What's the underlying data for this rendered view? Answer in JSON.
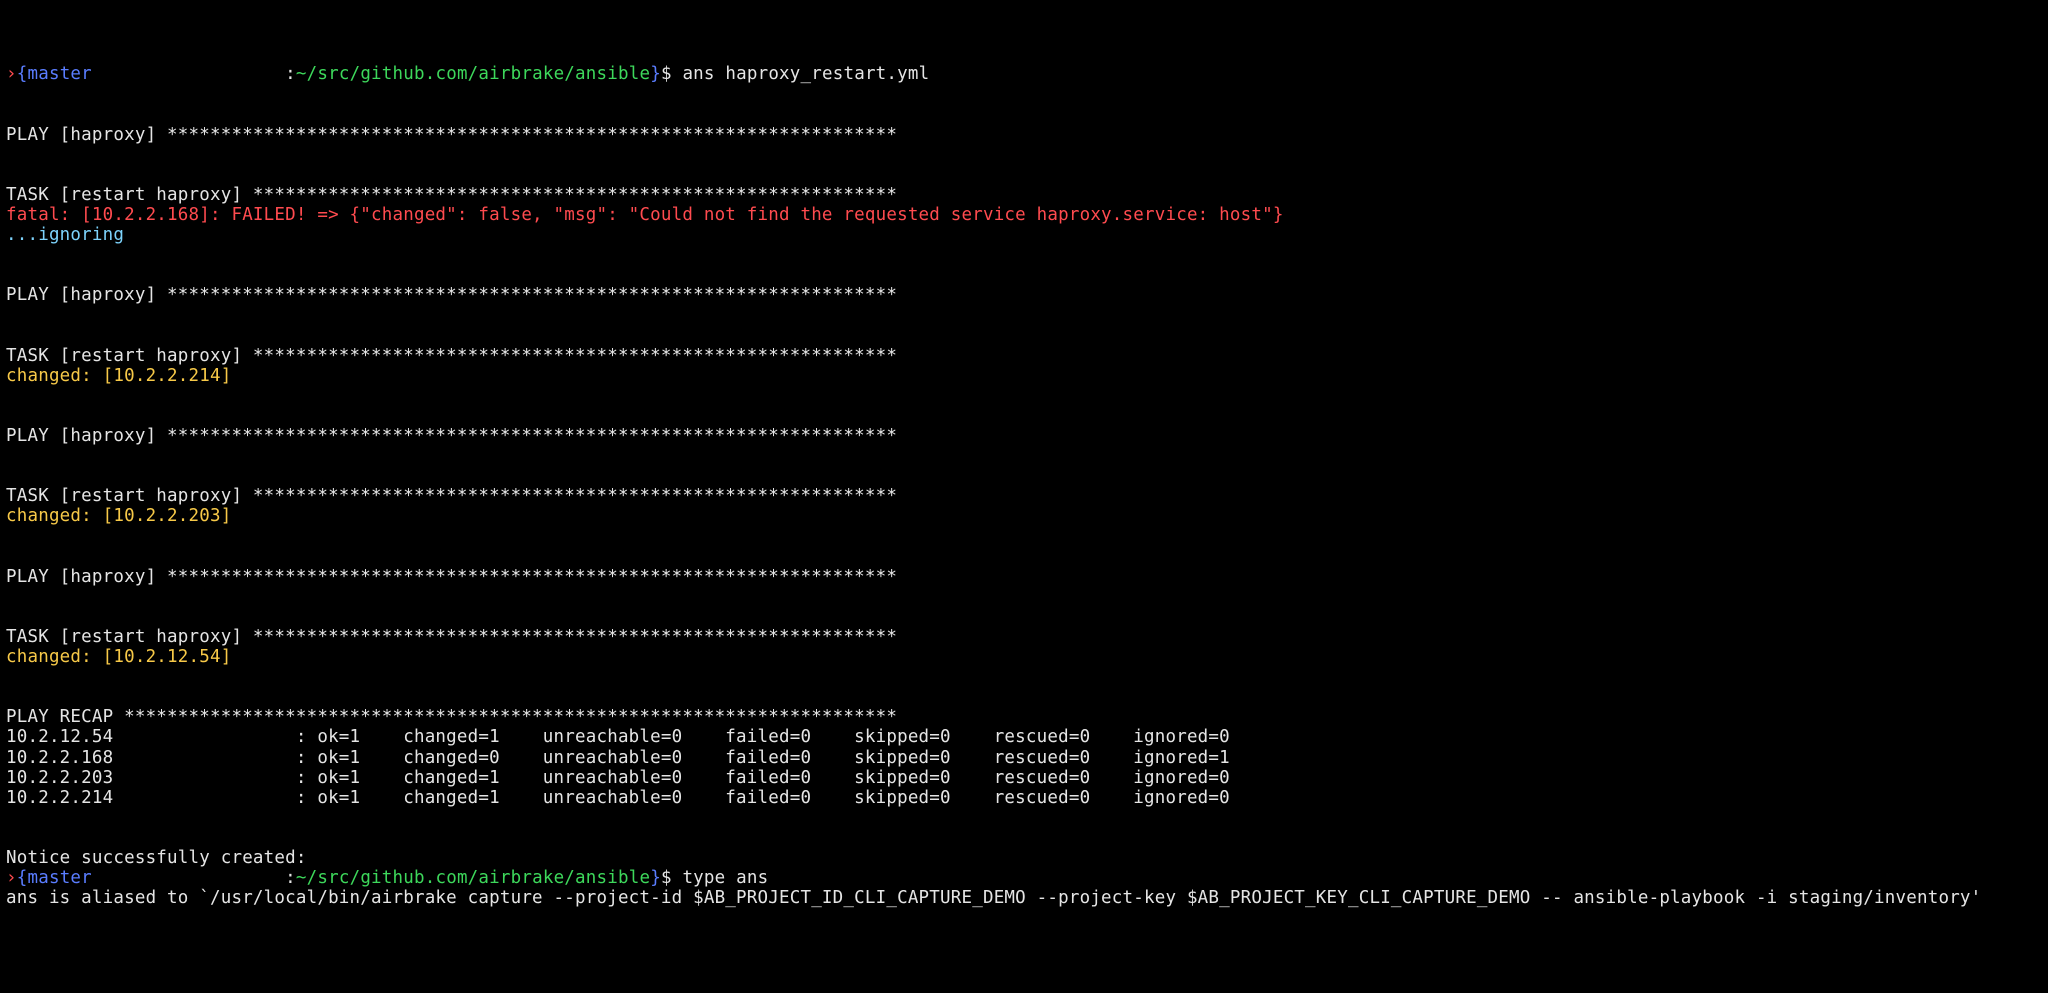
{
  "prompt1": {
    "chevron": "›",
    "branch": "{master",
    "sep_colon": ":",
    "cwd": "~/src/github.com/airbrake/ansible",
    "close_br": "}",
    "dollar": "$",
    "command": " ans haproxy_restart.yml"
  },
  "blank": "",
  "play_header": "PLAY [haproxy] ********************************************************************",
  "task_header": "TASK [restart haproxy] ************************************************************",
  "fatal_line": "fatal: [10.2.2.168]: FAILED! => {\"changed\": false, \"msg\": \"Could not find the requested service haproxy.service: host\"}",
  "ignoring": "...ignoring",
  "changed_214": "changed: [10.2.2.214]",
  "changed_203": "changed: [10.2.2.203]",
  "changed_54": "changed: [10.2.12.54]",
  "recap_header": "PLAY RECAP ************************************************************************",
  "recap_rows": [
    {
      "host": "10.2.12.54",
      "ok": 1,
      "changed": 1,
      "unreachable": 0,
      "failed": 0,
      "skipped": 0,
      "rescued": 0,
      "ignored": 0
    },
    {
      "host": "10.2.2.168",
      "ok": 1,
      "changed": 0,
      "unreachable": 0,
      "failed": 0,
      "skipped": 0,
      "rescued": 0,
      "ignored": 1
    },
    {
      "host": "10.2.2.203",
      "ok": 1,
      "changed": 1,
      "unreachable": 0,
      "failed": 0,
      "skipped": 0,
      "rescued": 0,
      "ignored": 0
    },
    {
      "host": "10.2.2.214",
      "ok": 1,
      "changed": 1,
      "unreachable": 0,
      "failed": 0,
      "skipped": 0,
      "rescued": 0,
      "ignored": 0
    }
  ],
  "recap_lines": {
    "r0": "10.2.12.54                 : ok=1    changed=1    unreachable=0    failed=0    skipped=0    rescued=0    ignored=0",
    "r1": "10.2.2.168                 : ok=1    changed=0    unreachable=0    failed=0    skipped=0    rescued=0    ignored=1",
    "r2": "10.2.2.203                 : ok=1    changed=1    unreachable=0    failed=0    skipped=0    rescued=0    ignored=0",
    "r3": "10.2.2.214                 : ok=1    changed=1    unreachable=0    failed=0    skipped=0    rescued=0    ignored=0"
  },
  "notice": "Notice successfully created:",
  "prompt2": {
    "chevron": "›",
    "branch": "{master",
    "sep_colon": ":",
    "cwd": "~/src/github.com/airbrake/ansible",
    "close_br": "}",
    "dollar": "$",
    "command": " type ans"
  },
  "alias_line": "ans is aliased to `/usr/local/bin/airbrake capture --project-id $AB_PROJECT_ID_CLI_CAPTURE_DEMO --project-key $AB_PROJECT_KEY_CLI_CAPTURE_DEMO -- ansible-playbook -i staging/inventory'"
}
